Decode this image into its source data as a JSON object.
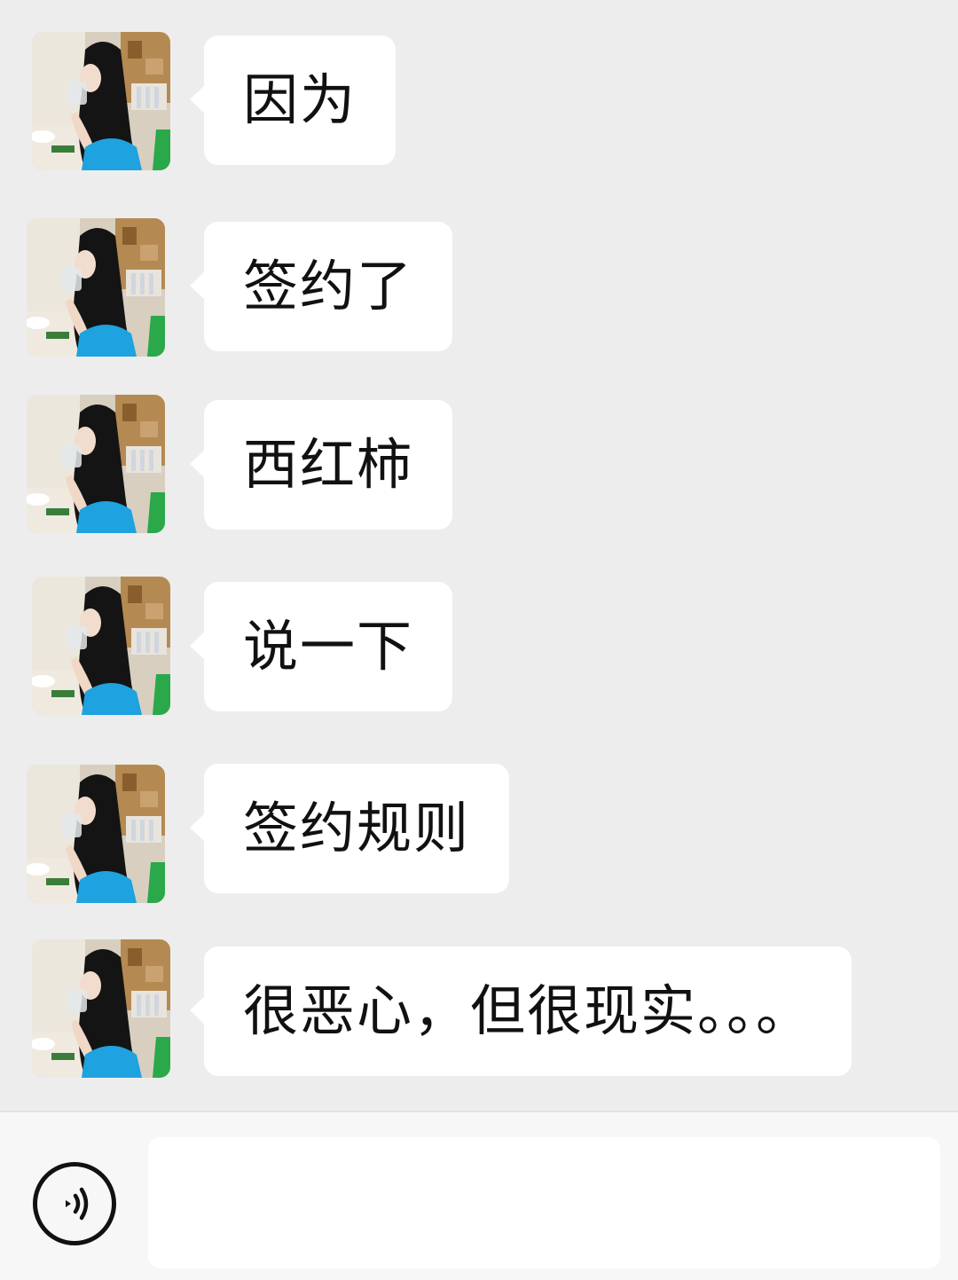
{
  "messages": [
    {
      "sender": "contact",
      "text": "因为"
    },
    {
      "sender": "contact",
      "text": "签约了"
    },
    {
      "sender": "contact",
      "text": "西红柿"
    },
    {
      "sender": "contact",
      "text": "说一下"
    },
    {
      "sender": "contact",
      "text": "签约规则"
    },
    {
      "sender": "contact",
      "text": "很恶心，但很现实。。。"
    }
  ],
  "input_bar": {
    "voice_icon": "voice-icon",
    "input_value": ""
  },
  "colors": {
    "chat_background": "#ededed",
    "bubble": "#ffffff",
    "input_bar": "#f7f7f7"
  }
}
